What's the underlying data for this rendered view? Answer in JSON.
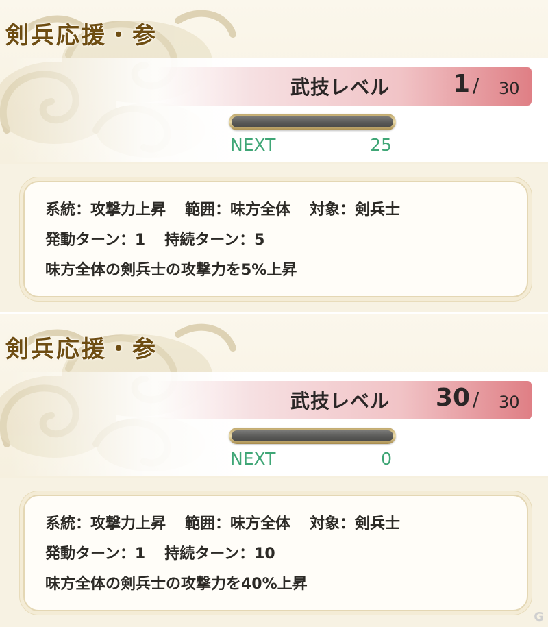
{
  "panels": [
    {
      "title": "剣兵応援・参",
      "level_label": "武技レベル",
      "level_current": "1",
      "level_slash": "/",
      "level_max": "30",
      "next_label": "NEXT",
      "next_value": "25",
      "desc": {
        "line1": [
          "系統：攻撃力上昇",
          "範囲：味方全体",
          "対象：剣兵士"
        ],
        "line2": [
          "発動ターン：1",
          "持続ターン：5"
        ],
        "line3": "味方全体の剣兵士の攻撃力を5%上昇"
      }
    },
    {
      "title": "剣兵応援・参",
      "level_label": "武技レベル",
      "level_current": "30",
      "level_slash": "/",
      "level_max": "30",
      "next_label": "NEXT",
      "next_value": "0",
      "desc": {
        "line1": [
          "系統：攻撃力上昇",
          "範囲：味方全体",
          "対象：剣兵士"
        ],
        "line2": [
          "発動ターン：1",
          "持続ターン：10"
        ],
        "line3": "味方全体の剣兵士の攻撃力を40%上昇"
      }
    }
  ],
  "watermark": "G",
  "icons": {
    "decoration": "cloud-swirl-icon"
  },
  "colors": {
    "title": "#6e4d12",
    "next_text": "#3fa676",
    "level_bar_end": "#df7f85",
    "panel_bg": "#f7f2e3"
  }
}
